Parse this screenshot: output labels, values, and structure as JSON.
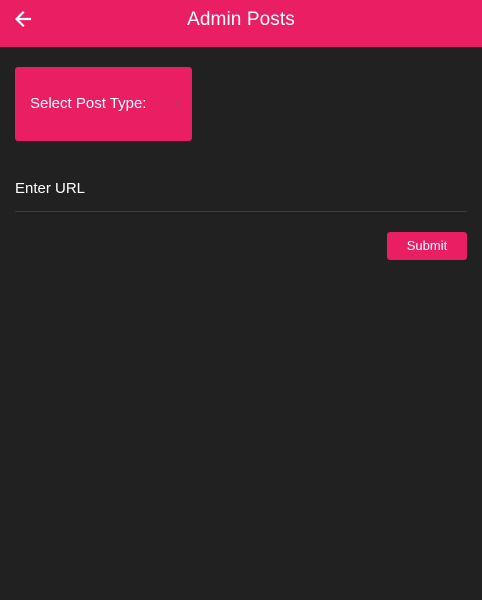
{
  "app_bar": {
    "title": "Admin Posts",
    "back_icon": "arrow-left-icon",
    "color": "#e91e63"
  },
  "form": {
    "post_type_select": {
      "label": "Select Post Type:",
      "caret_icon": "caret-down-icon"
    },
    "url_field": {
      "placeholder": "Enter URL",
      "value": ""
    },
    "submit_label": "Submit"
  },
  "colors": {
    "accent": "#e91e63",
    "background": "#212121",
    "text": "#ffffff"
  }
}
